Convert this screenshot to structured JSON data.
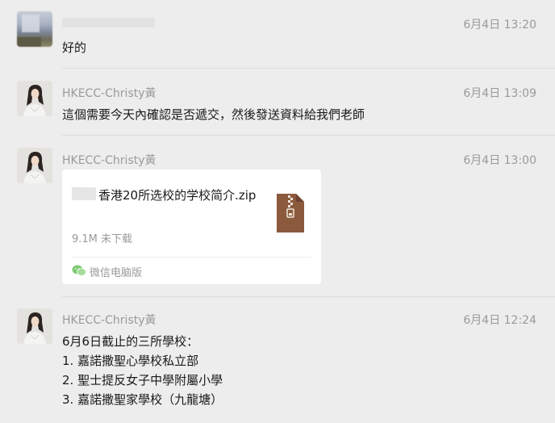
{
  "messages": [
    {
      "sender": "",
      "time": "6月4日 13:20",
      "text": "好的"
    },
    {
      "sender": "HKECC-Christy黃",
      "time": "6月4日 13:09",
      "text": "這個需要今天內確認是否遞交，然後發送資料給我們老師"
    },
    {
      "sender": "HKECC-Christy黃",
      "time": "6月4日 13:00",
      "file": {
        "name": "香港20所选校的学校简介.zip",
        "size_status": "9.1M 未下载",
        "source": "微信电脑版",
        "icon": "zip-file-icon"
      }
    },
    {
      "sender": "HKECC-Christy黃",
      "time": "6月4日 12:24",
      "title": "6月6日截止的三所學校：",
      "items": [
        "1. 嘉諾撒聖心學校私立部",
        "2. 聖士提反女子中學附屬小學",
        "3. 嘉諾撒聖家學校（九龍塘）"
      ]
    }
  ],
  "colors": {
    "background": "#ededed",
    "meta_text": "#9a9a9a",
    "zip_icon": "#8b5a3c",
    "wechat_green": "#7bc96f"
  }
}
